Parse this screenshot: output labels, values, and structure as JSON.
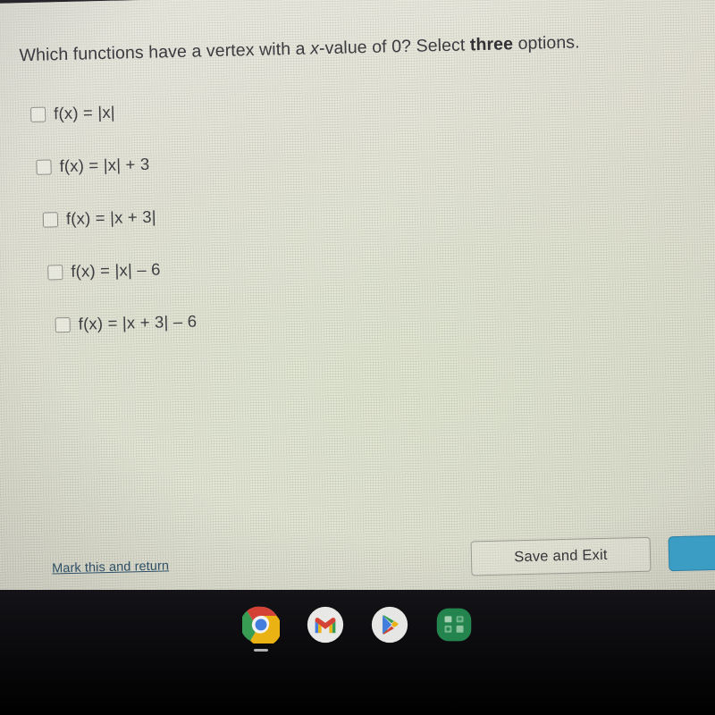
{
  "question": {
    "prefix": "Which functions have a vertex with a ",
    "italic_var": "x",
    "middle": "-value of 0? Select ",
    "emphasis": "three",
    "suffix": " options."
  },
  "options": [
    {
      "label": "f(x) = |x|",
      "checked": false
    },
    {
      "label": "f(x) = |x| + 3",
      "checked": false
    },
    {
      "label": "f(x) = |x + 3|",
      "checked": false
    },
    {
      "label": "f(x) = |x| – 6",
      "checked": false
    },
    {
      "label": "f(x) = |x + 3| – 6",
      "checked": false
    }
  ],
  "actions": {
    "mark_link": "Mark this and return",
    "save_exit": "Save and Exit",
    "next_button_color": "#3b9dc4"
  },
  "shelf": {
    "items": [
      {
        "name": "chrome-icon",
        "running": true
      },
      {
        "name": "gmail-icon",
        "running": false
      },
      {
        "name": "play-store-icon",
        "running": false
      },
      {
        "name": "green-app-icon",
        "running": false
      }
    ]
  },
  "colors": {
    "screen_background": "#e3e2d6",
    "text": "#3d3d42",
    "link": "#2f4f66",
    "accent": "#3b9dc4",
    "shelf": "#0a0a0d"
  }
}
